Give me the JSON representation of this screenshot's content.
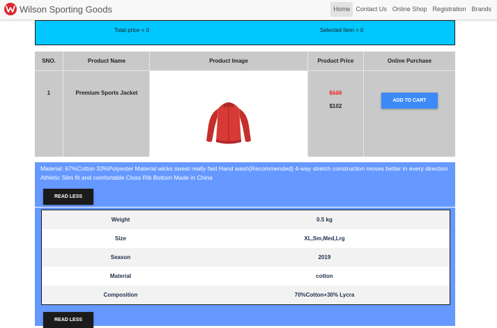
{
  "navbar": {
    "brand": "Wilson Sporting Goods",
    "links": [
      {
        "label": "Home"
      },
      {
        "label": "Contact Us"
      },
      {
        "label": "Online Shop"
      },
      {
        "label": "Registration"
      },
      {
        "label": "Brands"
      }
    ]
  },
  "summary": {
    "total": "Total price = 0",
    "selected": "Selected Item = 0"
  },
  "table": {
    "headers": [
      "SNO.",
      "Product Name",
      "Product Image",
      "Product Price",
      "Online Purchase"
    ],
    "row": {
      "sno": "1",
      "name": "Premium Sports Jacket",
      "old_price": "$120",
      "new_price": "$102",
      "button": "ADD TO CART"
    }
  },
  "description": {
    "text": "Material: 67%Cotton 33%Polyester Material wicks sweat really fast Hand wash(Recommended) 4-way stretch construction moves better in every direction Athletic Slim fit and comfortable Closs Rib Bottom Made in China",
    "button": "READ LESS"
  },
  "specs": {
    "rows": [
      {
        "key": "Weight",
        "value": "0.5 kg"
      },
      {
        "key": "Size",
        "value": "XL,Sm,Med,Lrg"
      },
      {
        "key": "Season",
        "value": "2019"
      },
      {
        "key": "Material",
        "value": "cotton"
      },
      {
        "key": "Composition",
        "value": "70%Cotton+30% Lycra"
      }
    ],
    "button": "READ LESS"
  },
  "colors": {
    "pricebar": "#00c8ff",
    "accent_blue": "#6699ff",
    "cart_button": "#3d8af7",
    "jacket": "#d83a36",
    "brand_red": "#d8282f"
  },
  "icons": {
    "brand": "wilson-w-logo-icon"
  }
}
